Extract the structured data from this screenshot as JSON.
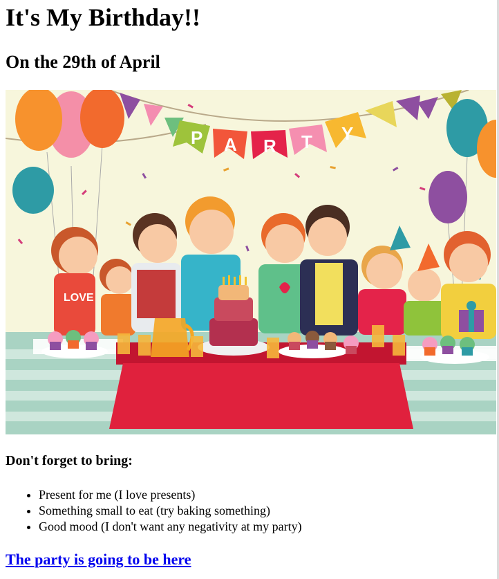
{
  "page": {
    "title": "It's My Birthday!!",
    "subtitle": "On the 29th of April"
  },
  "hero_image": {
    "banner_letters": [
      "P",
      "A",
      "R",
      "T",
      "Y"
    ],
    "cake_text": "LOVE"
  },
  "bring": {
    "heading": "Don't forget to bring:",
    "items": [
      "Present for me (I love presents)",
      "Something small to eat (try baking something)",
      "Good mood (I don't want any negativity at my party)"
    ]
  },
  "link": {
    "label": "The party is going to be here"
  },
  "colors": {
    "link": "#0000ee",
    "tablecloth": "#e0213d",
    "background": "#f7f6dc"
  }
}
